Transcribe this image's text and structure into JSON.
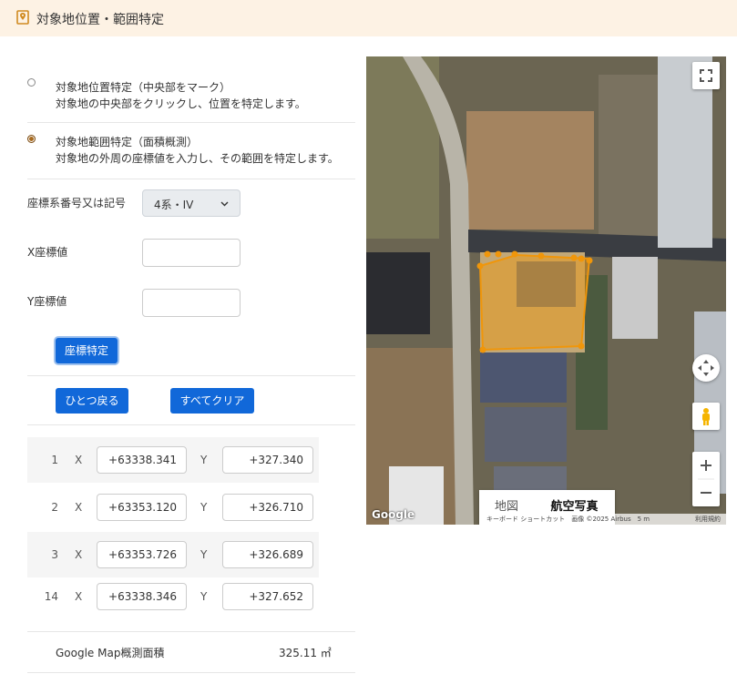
{
  "header": {
    "title": "対象地位置・範囲特定",
    "icon": "map-pin-icon"
  },
  "options": [
    {
      "title": "対象地位置特定（中央部をマーク）",
      "desc": "対象地の中央部をクリックし、位置を特定します。",
      "checked": false
    },
    {
      "title": "対象地範囲特定（面積概測）",
      "desc": "対象地の外周の座標値を入力し、その範囲を特定します。",
      "checked": true
    }
  ],
  "form": {
    "system_label": "座標系番号又は記号",
    "system_value": "4系・IV",
    "x_label": "X座標値",
    "y_label": "Y座標値",
    "locate_button": "座標特定",
    "back_button": "ひとつ戻る",
    "clear_button": "すべてクリア"
  },
  "coords": [
    {
      "n": "1",
      "x": "+63338.341",
      "y": "+327.340"
    },
    {
      "n": "2",
      "x": "+63353.120",
      "y": "+326.710"
    },
    {
      "n": "3",
      "x": "+63353.726",
      "y": "+326.689"
    },
    {
      "n": "14",
      "x": "+63338.346",
      "y": "+327.652"
    }
  ],
  "coord_labels": {
    "x": "X",
    "y": "Y"
  },
  "area": {
    "label": "Google Map概測面積",
    "value": "325.11 ㎡"
  },
  "map": {
    "type_map": "地図",
    "type_satellite": "航空写真",
    "attribution": "キーボード ショートカット　画像 ©2025 Airbus　5 m",
    "terms": "利用規約",
    "google": "Google",
    "polygon_color": "#f0960a",
    "accent": "#1168d9"
  }
}
